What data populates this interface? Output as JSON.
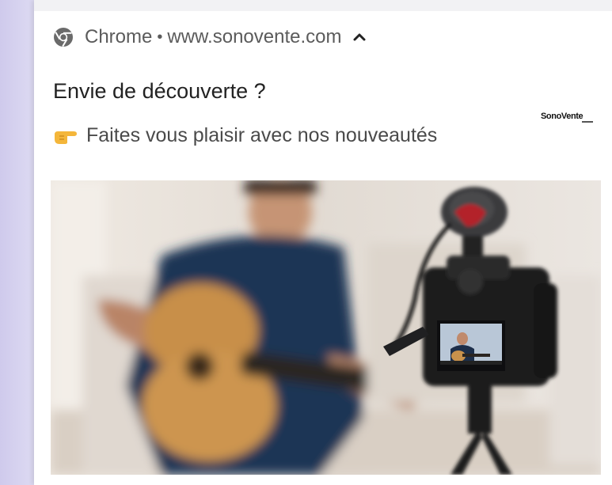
{
  "notification": {
    "app_name": "Chrome",
    "separator": "•",
    "site": "www.sonovente.com",
    "title": "Envie de découverte ?",
    "body": "Faites vous plaisir avec nos nouveautés",
    "body_emoji_icon": "pointing-hand-icon",
    "brand_logo": "SonoVente",
    "app_icon": "chrome-icon",
    "expand_icon": "chevron-up-icon"
  },
  "colors": {
    "card_background": "#ffffff",
    "page_background": "#d6d3ee",
    "header_text": "#5b5b5b",
    "title_text": "#222222"
  }
}
